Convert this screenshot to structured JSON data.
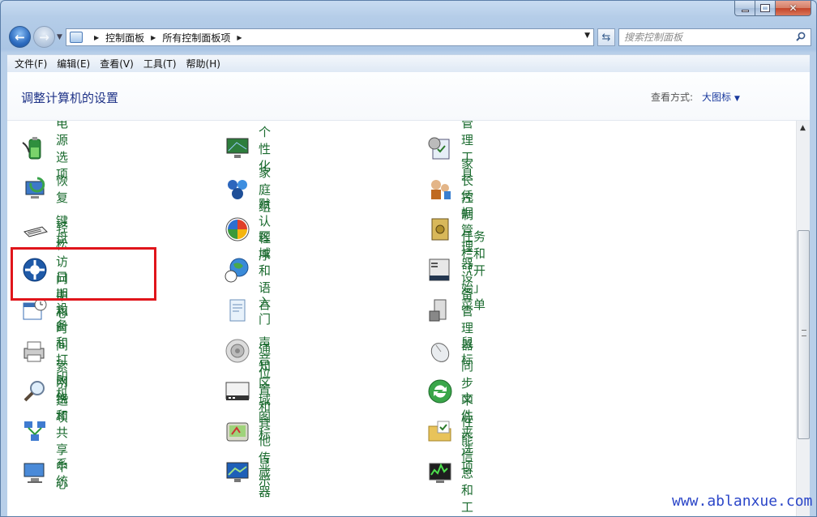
{
  "nav": {
    "breadcrumbs": [
      "控制面板",
      "所有控制面板项"
    ],
    "search_placeholder": "搜索控制面板"
  },
  "menu": [
    "文件(F)",
    "编辑(E)",
    "查看(V)",
    "工具(T)",
    "帮助(H)"
  ],
  "header": {
    "title": "调整计算机的设置",
    "view_label": "查看方式:",
    "view_value": "大图标"
  },
  "columns": [
    {
      "items": [
        {
          "label": "电源选项",
          "icon": "battery-icon"
        },
        {
          "label": "恢复",
          "icon": "recovery-icon"
        },
        {
          "label": "键盘",
          "icon": "keyboard-icon"
        },
        {
          "label": "轻松访问中心",
          "icon": "ease-of-access-icon"
        },
        {
          "label": "日期和时间",
          "icon": "calendar-clock-icon"
        },
        {
          "label": "设备和打印机",
          "icon": "printer-icon"
        },
        {
          "label": "索引选项",
          "icon": "magnifier-icon"
        },
        {
          "label": "网络和共享中心",
          "icon": "network-icon"
        },
        {
          "label": "系统",
          "icon": "computer-icon"
        }
      ]
    },
    {
      "items": [
        {
          "label": "个性化",
          "icon": "monitor-icon"
        },
        {
          "label": "家庭组",
          "icon": "homegroup-icon"
        },
        {
          "label": "默认程序",
          "icon": "default-programs-icon"
        },
        {
          "label": "区域和语言",
          "icon": "globe-clock-icon"
        },
        {
          "label": "入门",
          "icon": "getting-started-icon"
        },
        {
          "label": "声音",
          "icon": "speaker-icon"
        },
        {
          "label": "通知区域图标",
          "icon": "notification-area-icon"
        },
        {
          "label": "位置和其他传感器",
          "icon": "sensor-icon"
        },
        {
          "label": "显示",
          "icon": "display-icon"
        }
      ]
    },
    {
      "items": [
        {
          "label": "管理工具",
          "icon": "admin-tools-icon"
        },
        {
          "label": "家长控制",
          "icon": "parental-controls-icon"
        },
        {
          "label": "凭据管理器",
          "icon": "safe-icon"
        },
        {
          "label": "任务栏和「开始」菜单",
          "icon": "taskbar-icon"
        },
        {
          "label": "设备管理器",
          "icon": "device-manager-icon"
        },
        {
          "label": "鼠标",
          "icon": "mouse-icon"
        },
        {
          "label": "同步中心",
          "icon": "sync-icon"
        },
        {
          "label": "文件夹选项",
          "icon": "folder-icon"
        },
        {
          "label": "性能信息和工具",
          "icon": "performance-icon"
        }
      ]
    }
  ],
  "highlighted_item": "轻松访问中心",
  "watermark": "www.ablanxue.com"
}
